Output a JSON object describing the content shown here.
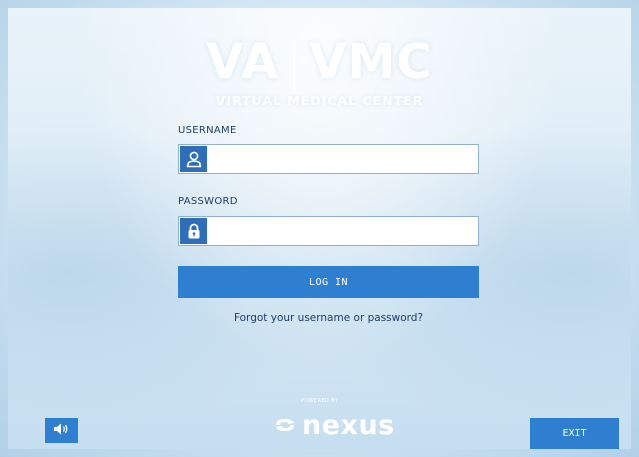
{
  "brand": {
    "logo_left": "VA",
    "logo_right": "VMC",
    "tagline": "VIRTUAL MEDICAL CENTER"
  },
  "login": {
    "username_label": "USERNAME",
    "username_value": "",
    "password_label": "PASSWORD",
    "password_value": "",
    "login_button": "LOG IN",
    "forgot_link": "Forgot your username or password?"
  },
  "footer": {
    "powered_by": "POWERED BY",
    "nexus_logo": "nexus",
    "exit_button": "EXIT",
    "sound_icon": "speaker-icon"
  },
  "colors": {
    "accent": "#2f7fd1",
    "icon_bg": "#2f6fb7",
    "text_dark": "#1d3f63"
  }
}
